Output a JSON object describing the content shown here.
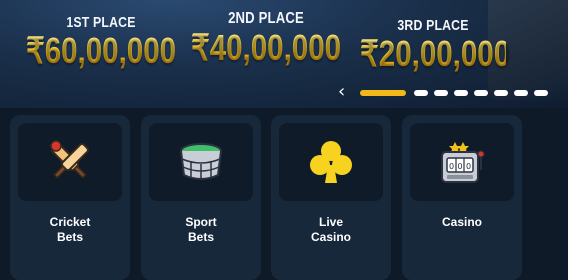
{
  "prizes": [
    {
      "place": "2ND PLACE",
      "amount": "₹40,00,000"
    },
    {
      "place": "1ST PLACE",
      "amount": "₹60,00,000"
    },
    {
      "place": "3RD PLACE",
      "amount": "₹20,00,000"
    }
  ],
  "carousel": {
    "prev_arrow": "‹",
    "slide_count": 8,
    "active_slide": 1
  },
  "categories": [
    {
      "line1": "Cricket",
      "line2": "Bets",
      "icon": "cricket-bat-ball-icon"
    },
    {
      "line1": "Sport",
      "line2": "Bets",
      "icon": "stadium-icon"
    },
    {
      "line1": "Live",
      "line2": "Casino",
      "icon": "club-suit-icon"
    },
    {
      "line1": "Casino",
      "line2": "",
      "icon": "slot-machine-icon"
    }
  ],
  "colors": {
    "gold": "#f5c21a",
    "card_bg": "#17283b",
    "icon_bg": "#0f1b29",
    "club_yellow": "#f7d21e"
  }
}
